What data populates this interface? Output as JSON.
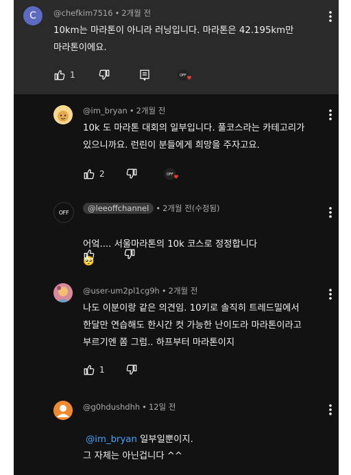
{
  "comments": [
    {
      "author": "@chefkim7516",
      "time": "2개월 전",
      "avatar_letter": "C",
      "avatar_color": "#5c6bc0",
      "lines": "10km는 마라톤이 아니라 러닝입니다. 마라톤은 42.195km만\n마라톤이에요.",
      "likes": "1"
    },
    {
      "author": "@im_bryan",
      "time": "2개월 전",
      "lines": "10k 도 마라톤 대회의 일부입니다. 풀코스라는 카테고리가\n있으니까요. 런린이 분들에게 희망을 주자고요.",
      "likes": "2"
    },
    {
      "author": "@leeoffchannel",
      "time": "2개월 전(수정됨)",
      "avatar_text": "OFF",
      "lines": "어엌.... 서울마라톤의 10k 코스로 정정합니다",
      "emoji": "🥺"
    },
    {
      "author": "@user-um2pl1cg9h",
      "time": "2개월 전",
      "lines": "나도 이분이랑 같은 의견임. 10키로 솔직히 트레드밀에서\n한달만 연습해도 한시간 컷 가능한 난이도라 마라톤이라고\n부르기엔 쫌 그럼.. 하프부터 마라톤이지",
      "likes": "1"
    },
    {
      "author": "@g0hdushdhh",
      "time": "12일 전",
      "mention": "@im_bryan",
      "line1_rest": " 일부일뿐이지.",
      "line2": "그 자체는 아닌겁니다 ^^"
    }
  ],
  "colors": {
    "background": "#121212",
    "highlight": "#2a2a2a",
    "link": "#3ea6ff",
    "heart": "#e53935"
  }
}
